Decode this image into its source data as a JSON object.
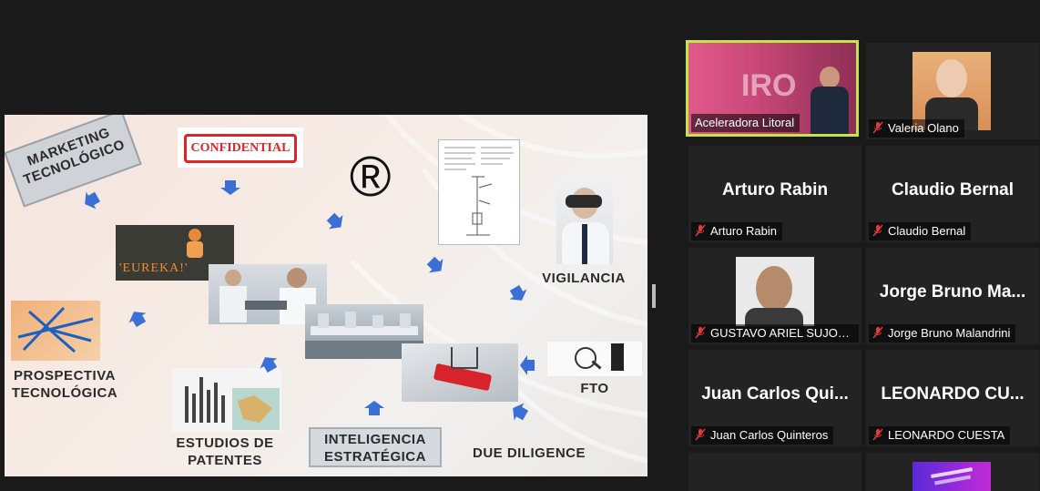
{
  "slide": {
    "marketing": "MARKETING\nTECNOLÓGICO",
    "confidential": "CONFIDENTIAL",
    "registered_symbol": "®",
    "vigilancia": "VIGILANCIA",
    "fto": "FTO",
    "prospectiva": "PROSPECTIVA\nTECNOLÓGICA",
    "estudios": "ESTUDIOS DE\nPATENTES",
    "inteligencia": "INTELIGENCIA\nESTRATÉGICA",
    "due_diligence": "DUE DILIGENCE",
    "eureka": "'EUREKA!'"
  },
  "participants": [
    {
      "id": "acel",
      "tile_text": "",
      "name": "Aceleradora Litoral",
      "muted": false,
      "active": true,
      "has_video": true
    },
    {
      "id": "valeria",
      "tile_text": "",
      "name": "Valeria Olano",
      "muted": true,
      "active": false,
      "has_video": true
    },
    {
      "id": "arturo",
      "tile_text": "Arturo Rabin",
      "name": "Arturo Rabin",
      "muted": true,
      "active": false,
      "has_video": false
    },
    {
      "id": "claudio",
      "tile_text": "Claudio Bernal",
      "name": "Claudio Bernal",
      "muted": true,
      "active": false,
      "has_video": false
    },
    {
      "id": "gustavo",
      "tile_text": "",
      "name": "GUSTAVO ARIEL SUJONIT...",
      "muted": true,
      "active": false,
      "has_video": true
    },
    {
      "id": "jorge",
      "tile_text": "Jorge Bruno Ma...",
      "name": "Jorge Bruno Malandrini",
      "muted": true,
      "active": false,
      "has_video": false
    },
    {
      "id": "juan",
      "tile_text": "Juan Carlos Qui...",
      "name": "Juan Carlos Quinteros",
      "muted": true,
      "active": false,
      "has_video": false
    },
    {
      "id": "leonardo",
      "tile_text": "LEONARDO CU...",
      "name": "LEONARDO CUESTA",
      "muted": true,
      "active": false,
      "has_video": false
    }
  ],
  "colors": {
    "active_border": "#c6e34a",
    "arrow": "#3b6fd6",
    "muted_icon": "#e03b3b"
  }
}
